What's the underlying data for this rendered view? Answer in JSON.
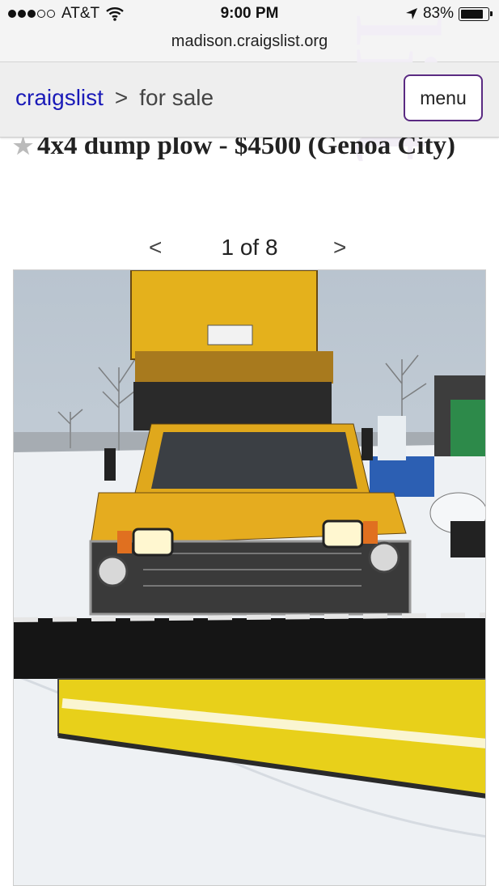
{
  "status_bar": {
    "carrier": "AT&T",
    "time": "9:00 PM",
    "battery": "83%",
    "battery_level": 0.83,
    "signal_bars": 3,
    "signal_total": 5,
    "url": "madison.craigslist.org"
  },
  "nav": {
    "home_link": "craigslist",
    "separator": ">",
    "section": "for sale",
    "menu_label": "menu"
  },
  "listing": {
    "title": "4x4 dump plow - $4500 (Genoa City)"
  },
  "gallery": {
    "prev": "<",
    "counter": "1 of 8",
    "next": ">"
  },
  "colors": {
    "link": "#1a1ab8",
    "menu_border": "#5a2a82",
    "truck_yellow": "#e8b520"
  },
  "icons": [
    "wifi-icon",
    "location-arrow-icon",
    "battery-icon",
    "star-icon"
  ]
}
